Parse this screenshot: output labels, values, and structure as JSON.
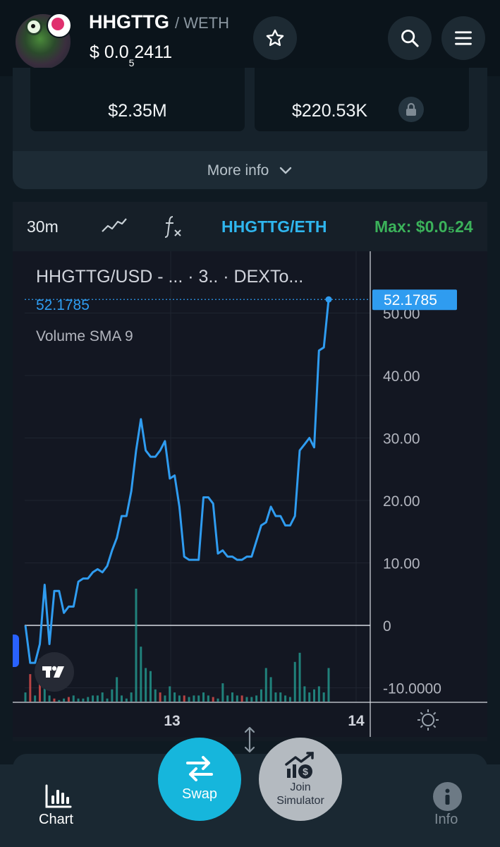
{
  "header": {
    "pair_base": "HHGTTG",
    "pair_quote": "/ WETH",
    "price_prefix": "$ 0.0",
    "price_zeros": "5",
    "price_digits": "2411"
  },
  "stats": {
    "market_cap": "$2.35M",
    "liquidity": "$220.53K",
    "more_info_label": "More info"
  },
  "toolbar": {
    "timeframe": "30m",
    "pair_link": "HHGTTG/ETH",
    "max_label": "Max: $0.0₅24"
  },
  "chart_legend": {
    "title": "HHGTTG/USD - ... · 3.. · DEXTo...",
    "last_value": "52.1785",
    "volume_indicator": "Volume SMA 9"
  },
  "chart_data": {
    "type": "line",
    "title": "HHGTTG/USD",
    "y_ticks": [
      "50.00",
      "40.00",
      "30.00",
      "20.00",
      "10.00",
      "0",
      "-10.0000"
    ],
    "x_ticks": [
      "13",
      "14"
    ],
    "ylim": [
      -12,
      55
    ],
    "last_price": 52.1785,
    "price_label": "52.1785",
    "series": [
      {
        "color": "#2f9cf0",
        "values": [
          0,
          -6,
          -6,
          -3,
          6.5,
          -3,
          5.5,
          5.5,
          2,
          3,
          3,
          7,
          7.5,
          7.5,
          8.5,
          9,
          8.5,
          9.5,
          12,
          14,
          17.5,
          17.5,
          21.5,
          28,
          33,
          28,
          27,
          27,
          28,
          29.5,
          23.5,
          24,
          19,
          11,
          10.5,
          10.5,
          10.5,
          20.5,
          20.5,
          19.5,
          11.5,
          12,
          11,
          11,
          10.5,
          10.5,
          11,
          11,
          13.5,
          16,
          16.5,
          19,
          17.5,
          17.5,
          16,
          16,
          17.5,
          28,
          29,
          30,
          28.5,
          44,
          44.5,
          52.18
        ]
      }
    ],
    "volume": {
      "up_color": "#26a69a",
      "down_color": "#ef5350",
      "values": [
        3,
        9,
        2,
        14,
        6,
        2,
        1,
        0.5,
        1,
        1.5,
        2,
        1,
        1,
        1.5,
        2,
        2,
        3,
        1,
        4,
        8,
        2,
        1,
        3,
        37,
        18,
        11,
        10,
        4,
        3,
        2,
        5,
        3,
        2,
        2,
        1.5,
        2,
        2,
        3,
        2,
        1.5,
        1,
        6,
        2,
        3,
        2,
        2,
        1.5,
        1.5,
        2,
        4,
        11,
        8,
        3,
        3,
        2,
        1.5,
        13,
        16,
        5,
        3,
        4,
        5,
        3,
        11
      ],
      "down": [
        1,
        3,
        6,
        9,
        28,
        33,
        39,
        45
      ]
    },
    "grid": true
  },
  "nav": {
    "chart_label": "Chart",
    "swap_label": "Swap",
    "simulator_label": "Join\nSimulator",
    "info_label": "Info"
  }
}
